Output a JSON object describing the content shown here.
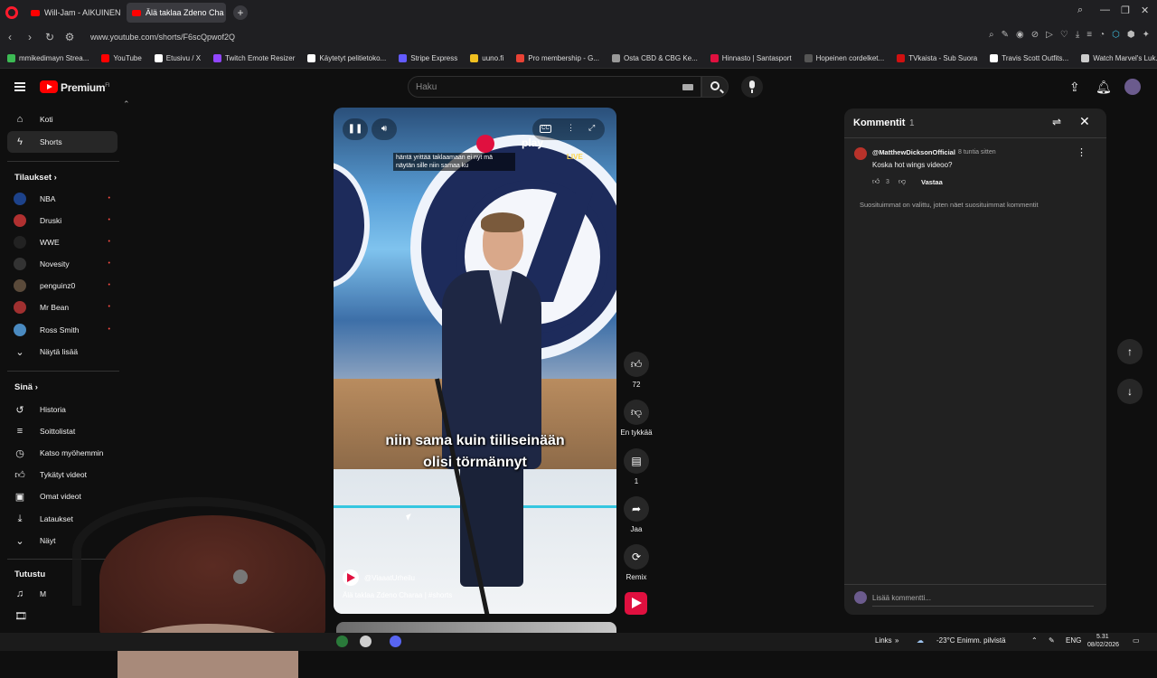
{
  "browser": {
    "tabs": [
      {
        "label": "Will-Jam - AIKUINEN - Yo",
        "active": false
      },
      {
        "label": "Älä taklaa Zdeno Cha",
        "active": true
      }
    ],
    "new_tab_label": "+",
    "url": "www.youtube.com/shorts/F6scQpwof2Q",
    "bookmarks": [
      {
        "label": "mmikedimayn Strea...",
        "color": "#3cba54"
      },
      {
        "label": "YouTube",
        "color": "#ff0000"
      },
      {
        "label": "Etusivu / X",
        "color": "#ffffff"
      },
      {
        "label": "Twitch Emote Resizer",
        "color": "#9146ff"
      },
      {
        "label": "Käytetyt pelitietoko...",
        "color": "#ffffff"
      },
      {
        "label": "Stripe Express",
        "color": "#635bff"
      },
      {
        "label": "uuno.fi",
        "color": "#f0c020"
      },
      {
        "label": "Pro membership - G...",
        "color": "#e94235"
      },
      {
        "label": "Osta CBD & CBG Ke...",
        "color": "#999999"
      },
      {
        "label": "Hinnasto | Santasport",
        "color": "#e0103f"
      },
      {
        "label": "Hopeinen cordelket...",
        "color": "#333333"
      },
      {
        "label": "TVkaista - Sub Suora",
        "color": "#d01010"
      },
      {
        "label": "Travis Scott Outfits...",
        "color": "#ffffff"
      },
      {
        "label": "Watch Marvel's Luk...",
        "color": "#cccccc"
      }
    ]
  },
  "header": {
    "logo_text": "Premium",
    "logo_sup": "FI",
    "search_placeholder": "Haku"
  },
  "sidebar": {
    "main": [
      {
        "label": "Koti",
        "icon": "home-icon"
      },
      {
        "label": "Shorts",
        "icon": "shorts-icon",
        "active": true
      }
    ],
    "subs_heading": "Tilaukset",
    "subs": [
      {
        "label": "NBA",
        "color": "#1d428a",
        "live": "•"
      },
      {
        "label": "Druski",
        "color": "#b03030",
        "live": "•"
      },
      {
        "label": "WWE",
        "color": "#222222",
        "live": "•"
      },
      {
        "label": "Novesity",
        "color": "#333333",
        "live": "•"
      },
      {
        "label": "penguinz0",
        "color": "#5a4a3a",
        "live": "•"
      },
      {
        "label": "Mr Bean",
        "color": "#a03030",
        "live": "•"
      },
      {
        "label": "Ross Smith",
        "color": "#4a8ac0",
        "live": "•"
      }
    ],
    "show_more": "Näytä lisää",
    "you_heading": "Sinä",
    "you": [
      {
        "label": "Historia",
        "icon": "history-icon"
      },
      {
        "label": "Soittolistat",
        "icon": "playlist-icon"
      },
      {
        "label": "Katso myöhemmin",
        "icon": "clock-icon"
      },
      {
        "label": "Tykätyt videot",
        "icon": "thumbs-up-icon"
      },
      {
        "label": "Omat videot",
        "icon": "video-icon"
      },
      {
        "label": "Lataukset",
        "icon": "download-icon"
      },
      {
        "label": "Näyt",
        "icon": "chevron-down-icon"
      }
    ],
    "explore_heading": "Tutustu",
    "explore": [
      {
        "label": "M",
        "icon": "music-icon"
      }
    ]
  },
  "video": {
    "top_caption": "häntä yrittää taklaamaan ei nyt mä näytän sille niin samaa ku",
    "brand_text": "play",
    "live_label": "LIVE",
    "subtitle_line1": "niin sama kuin tiiliseinään",
    "subtitle_line2": "olisi törmännyt",
    "channel": "@ViaaatUrheilu",
    "title": "Älä taklaa Zdeno Charaa | #shorts"
  },
  "actions": {
    "likes": "72",
    "dislike_label": "En tykkää",
    "comments_count": "1",
    "share_label": "Jaa",
    "remix_label": "Remix"
  },
  "comments": {
    "title": "Kommentit",
    "count": "1",
    "items": [
      {
        "user": "@MatthewDicksonOfficial",
        "time": "8 tuntia sitten",
        "text": "Koska hot wings videoo?",
        "likes": "3",
        "reply": "Vastaa"
      }
    ],
    "note": "Suosituimmat on valittu, joten näet suosituimmat kommentit",
    "input_placeholder": "Lisää kommentti..."
  },
  "taskbar": {
    "links": "Links",
    "weather": "-23°C  Enimm. pilvistä",
    "lang": "ENG",
    "time": "5.31",
    "date": "08/02/2026"
  }
}
